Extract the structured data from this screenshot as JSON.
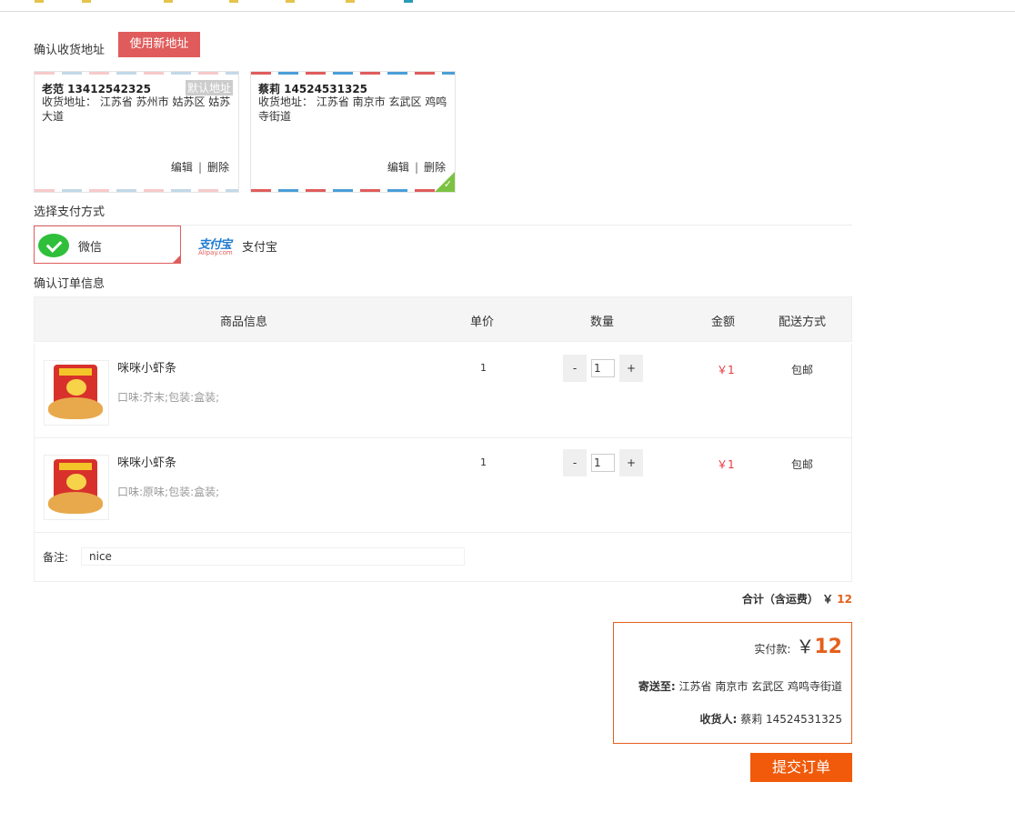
{
  "address": {
    "section_title": "确认收货地址",
    "new_address_label": "使用新地址",
    "cards": [
      {
        "name_phone": "老范 13412542325",
        "default_badge": "默认地址",
        "detail": "收货地址： 江苏省 苏州市 姑苏区 姑苏大道",
        "edit": "编辑",
        "sep": "|",
        "delete": "删除",
        "selected": false
      },
      {
        "name_phone": "蔡莉 14524531325",
        "detail": "收货地址： 江苏省 南京市 玄武区 鸡鸣寺街道",
        "edit": "编辑",
        "sep": "|",
        "delete": "删除",
        "selected": true
      }
    ]
  },
  "payment": {
    "section_title": "选择支付方式",
    "options": [
      {
        "label": "微信",
        "icon": "wechat-icon",
        "selected": true
      },
      {
        "label": "支付宝",
        "icon": "alipay-logo",
        "logo_text": "支付宝",
        "logo_sub": "Alipay.com",
        "selected": false
      }
    ]
  },
  "order": {
    "section_title": "确认订单信息",
    "headers": {
      "product": "商品信息",
      "unit_price": "单价",
      "qty": "数量",
      "amount": "金额",
      "shipping": "配送方式"
    },
    "items": [
      {
        "name": "咪咪小虾条",
        "attrs": "口味:芥末;包装:盒装;",
        "price": "1",
        "qty": "1",
        "minus": "-",
        "plus": "+",
        "amount": "￥1",
        "shipping": "包邮"
      },
      {
        "name": "咪咪小虾条",
        "attrs": "口味:原味;包装:盒装;",
        "price": "1",
        "qty": "1",
        "minus": "-",
        "plus": "+",
        "amount": "￥1",
        "shipping": "包邮"
      }
    ],
    "note_label": "备注:",
    "note_value": "nice"
  },
  "totals": {
    "total_label": "合计（含运费）",
    "total_currency": "￥",
    "total_value": "12",
    "paid_label": "实付款:",
    "paid_currency": "￥",
    "paid_value": "12",
    "ship_to_label": "寄送至:",
    "ship_to_value": "江苏省 南京市 玄武区 鸡鸣寺街道",
    "receiver_label": "收货人:",
    "receiver_value": "蔡莉 14524531325"
  },
  "submit_label": "提交订单",
  "colors": {
    "accent": "#e05c5c",
    "orange": "#f05a0a",
    "price_red": "#e4393c",
    "check_green": "#7cc242"
  }
}
